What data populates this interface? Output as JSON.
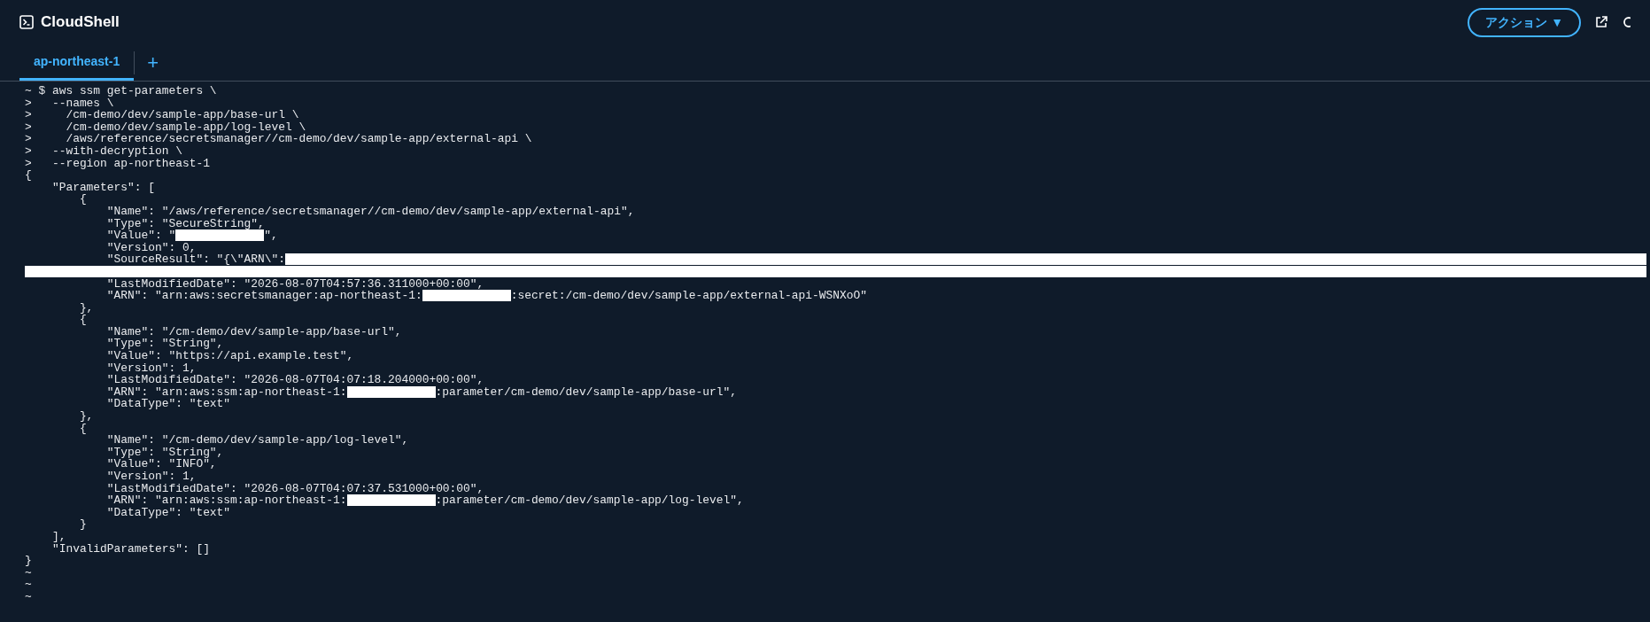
{
  "header": {
    "title": "CloudShell",
    "action_button": "アクション ▼"
  },
  "tabs": [
    {
      "label": "ap-northeast-1",
      "selected": true
    }
  ],
  "add_tab": "+",
  "terminal": {
    "lines": [
      {
        "parts": [
          {
            "kind": "text",
            "text": "~ $ aws ssm get-parameters \\"
          }
        ]
      },
      {
        "parts": [
          {
            "kind": "text",
            "text": ">   --names \\"
          }
        ]
      },
      {
        "parts": [
          {
            "kind": "text",
            "text": ">     /cm-demo/dev/sample-app/base-url \\"
          }
        ]
      },
      {
        "parts": [
          {
            "kind": "text",
            "text": ">     /cm-demo/dev/sample-app/log-level \\"
          }
        ]
      },
      {
        "parts": [
          {
            "kind": "text",
            "text": ">     /aws/reference/secretsmanager//cm-demo/dev/sample-app/external-api \\"
          }
        ]
      },
      {
        "parts": [
          {
            "kind": "text",
            "text": ">   --with-decryption \\"
          }
        ]
      },
      {
        "parts": [
          {
            "kind": "text",
            "text": ">   --region ap-northeast-1"
          }
        ]
      },
      {
        "parts": [
          {
            "kind": "text",
            "text": "{"
          }
        ]
      },
      {
        "parts": [
          {
            "kind": "text",
            "text": "    \"Parameters\": ["
          }
        ]
      },
      {
        "parts": [
          {
            "kind": "text",
            "text": "        {"
          }
        ]
      },
      {
        "parts": [
          {
            "kind": "text",
            "text": "            \"Name\": \"/aws/reference/secretsmanager//cm-demo/dev/sample-app/external-api\","
          }
        ]
      },
      {
        "parts": [
          {
            "kind": "text",
            "text": "            \"Type\": \"SecureString\","
          }
        ]
      },
      {
        "parts": [
          {
            "kind": "text",
            "text": "            \"Value\": \""
          },
          {
            "kind": "redaction"
          },
          {
            "kind": "text",
            "text": "\","
          }
        ]
      },
      {
        "parts": [
          {
            "kind": "text",
            "text": "            \"Version\": 0,"
          }
        ]
      },
      {
        "parts": [
          {
            "kind": "text",
            "text": "            \"SourceResult\": \"{\\\"ARN\\\":"
          },
          {
            "kind": "redaction"
          }
        ]
      },
      {
        "parts": [
          {
            "kind": "redaction"
          }
        ]
      },
      {
        "parts": [
          {
            "kind": "text",
            "text": "            \"LastModifiedDate\": \"2026-08-07T04:57:36.311000+00:00\","
          }
        ]
      },
      {
        "parts": [
          {
            "kind": "text",
            "text": "            \"ARN\": \"arn:aws:secretsmanager:ap-northeast-1:"
          },
          {
            "kind": "redaction"
          },
          {
            "kind": "text",
            "text": ":secret:/cm-demo/dev/sample-app/external-api-WSNXoO\""
          }
        ]
      },
      {
        "parts": [
          {
            "kind": "text",
            "text": "        },"
          }
        ]
      },
      {
        "parts": [
          {
            "kind": "text",
            "text": "        {"
          }
        ]
      },
      {
        "parts": [
          {
            "kind": "text",
            "text": "            \"Name\": \"/cm-demo/dev/sample-app/base-url\","
          }
        ]
      },
      {
        "parts": [
          {
            "kind": "text",
            "text": "            \"Type\": \"String\","
          }
        ]
      },
      {
        "parts": [
          {
            "kind": "text",
            "text": "            \"Value\": \"https://api.example.test\","
          }
        ]
      },
      {
        "parts": [
          {
            "kind": "text",
            "text": "            \"Version\": 1,"
          }
        ]
      },
      {
        "parts": [
          {
            "kind": "text",
            "text": "            \"LastModifiedDate\": \"2026-08-07T04:07:18.204000+00:00\","
          }
        ]
      },
      {
        "parts": [
          {
            "kind": "text",
            "text": "            \"ARN\": \"arn:aws:ssm:ap-northeast-1:"
          },
          {
            "kind": "redaction"
          },
          {
            "kind": "text",
            "text": ":parameter/cm-demo/dev/sample-app/base-url\","
          }
        ]
      },
      {
        "parts": [
          {
            "kind": "text",
            "text": "            \"DataType\": \"text\""
          }
        ]
      },
      {
        "parts": [
          {
            "kind": "text",
            "text": "        },"
          }
        ]
      },
      {
        "parts": [
          {
            "kind": "text",
            "text": "        {"
          }
        ]
      },
      {
        "parts": [
          {
            "kind": "text",
            "text": "            \"Name\": \"/cm-demo/dev/sample-app/log-level\","
          }
        ]
      },
      {
        "parts": [
          {
            "kind": "text",
            "text": "            \"Type\": \"String\","
          }
        ]
      },
      {
        "parts": [
          {
            "kind": "text",
            "text": "            \"Value\": \"INFO\","
          }
        ]
      },
      {
        "parts": [
          {
            "kind": "text",
            "text": "            \"Version\": 1,"
          }
        ]
      },
      {
        "parts": [
          {
            "kind": "text",
            "text": "            \"LastModifiedDate\": \"2026-08-07T04:07:37.531000+00:00\","
          }
        ]
      },
      {
        "parts": [
          {
            "kind": "text",
            "text": "            \"ARN\": \"arn:aws:ssm:ap-northeast-1:"
          },
          {
            "kind": "redaction"
          },
          {
            "kind": "text",
            "text": ":parameter/cm-demo/dev/sample-app/log-level\","
          }
        ]
      },
      {
        "parts": [
          {
            "kind": "text",
            "text": "            \"DataType\": \"text\""
          }
        ]
      },
      {
        "parts": [
          {
            "kind": "text",
            "text": "        }"
          }
        ]
      },
      {
        "parts": [
          {
            "kind": "text",
            "text": "    ],"
          }
        ]
      },
      {
        "parts": [
          {
            "kind": "text",
            "text": "    \"InvalidParameters\": []"
          }
        ]
      },
      {
        "parts": [
          {
            "kind": "text",
            "text": "}"
          }
        ]
      },
      {
        "parts": [
          {
            "kind": "text",
            "text": "~"
          }
        ]
      },
      {
        "parts": [
          {
            "kind": "text",
            "text": "~"
          }
        ]
      },
      {
        "parts": [
          {
            "kind": "text",
            "text": "~"
          }
        ]
      }
    ]
  }
}
